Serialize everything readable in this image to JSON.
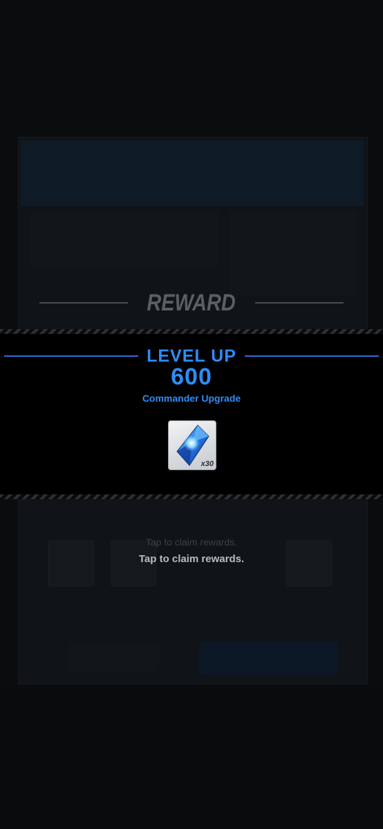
{
  "reward": {
    "title": "REWARD"
  },
  "banner": {
    "heading": "LEVEL UP",
    "level": "600",
    "subtitle": "Commander Upgrade"
  },
  "items": [
    {
      "icon": "blue-crystal-icon",
      "quantity": "x30"
    }
  ],
  "claim": {
    "hint_faded": "Tap to claim rewards.",
    "hint": "Tap to claim rewards."
  },
  "colors": {
    "accent": "#2f8cf6",
    "background": "#0b0c0e",
    "banner": "#000000",
    "muted": "#5b5e63"
  }
}
